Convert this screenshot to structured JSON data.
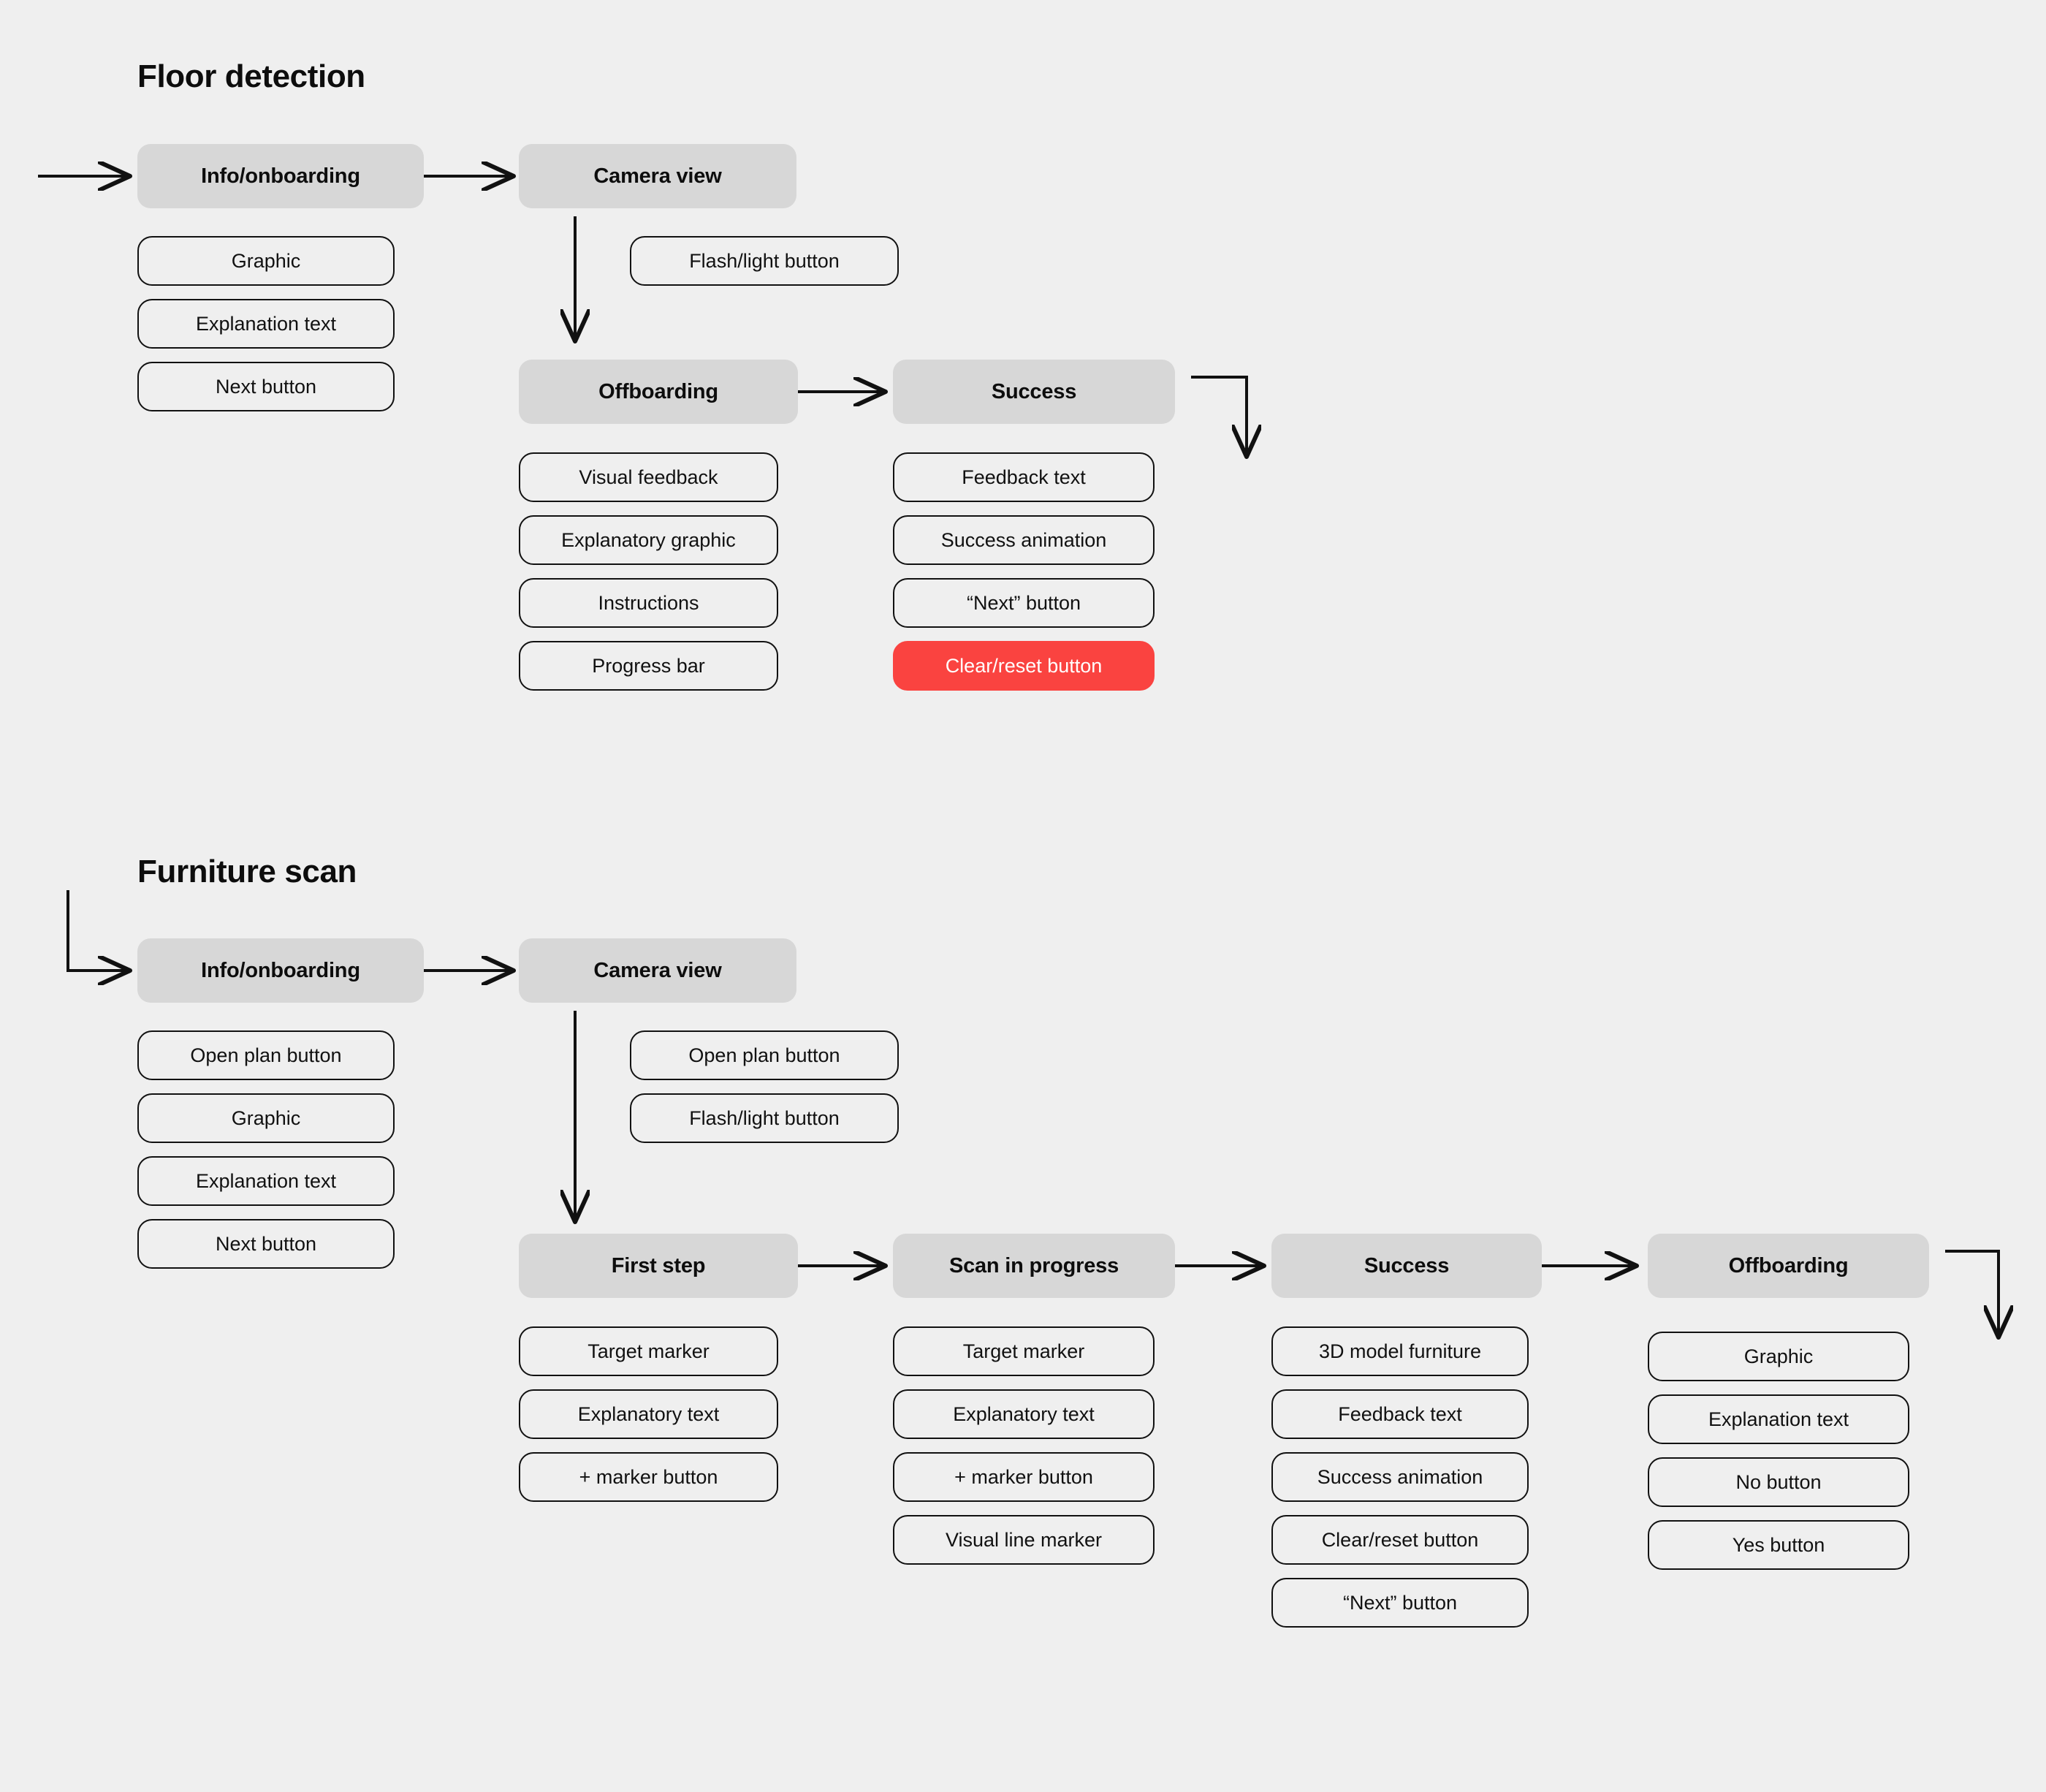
{
  "diagram": {
    "background_color": "#efefef",
    "screen_box_color": "#d7d7d7",
    "accent_color": "#fa4340",
    "line_color": "#111111"
  },
  "sections": [
    {
      "title": "Floor detection",
      "columns": [
        {
          "screen": "Info/onboarding",
          "components": [
            "Graphic",
            "Explanation text",
            "Next button"
          ]
        },
        {
          "screen": "Camera view",
          "components": [
            "Flash/light button"
          ]
        },
        {
          "screen": "Offboarding",
          "components": [
            "Visual feedback",
            "Explanatory graphic",
            "Instructions",
            "Progress bar"
          ]
        },
        {
          "screen": "Success",
          "components": [
            "Feedback text",
            "Success animation",
            "“Next” button",
            "Clear/reset button"
          ],
          "danger_index": 3
        }
      ]
    },
    {
      "title": "Furniture scan",
      "columns": [
        {
          "screen": "Info/onboarding",
          "components": [
            "Open plan button",
            "Graphic",
            "Explanation text",
            "Next button"
          ]
        },
        {
          "screen": "Camera view",
          "components": [
            "Open plan button",
            "Flash/light button"
          ]
        },
        {
          "screen": "First step",
          "components": [
            "Target marker",
            "Explanatory text",
            "+ marker button"
          ]
        },
        {
          "screen": "Scan in progress",
          "components": [
            "Target marker",
            "Explanatory text",
            "+ marker button",
            "Visual line marker"
          ]
        },
        {
          "screen": "Success",
          "components": [
            "3D model furniture",
            "Feedback text",
            "Success animation",
            "Clear/reset button",
            "“Next” button"
          ]
        },
        {
          "screen": "Offboarding",
          "components": [
            "Graphic",
            "Explanation text",
            "No button",
            "Yes button"
          ]
        }
      ]
    }
  ]
}
